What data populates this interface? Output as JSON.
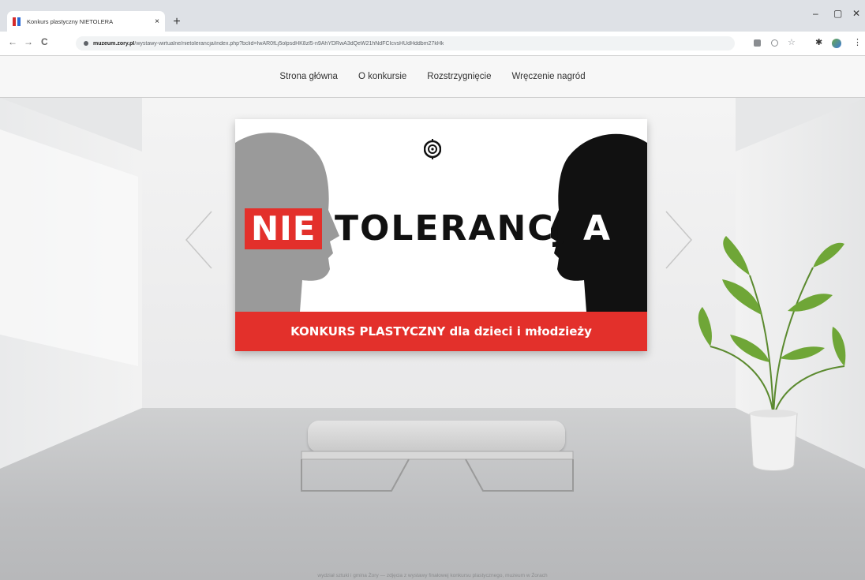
{
  "browser": {
    "tab_title": "Konkurs plastyczny NIETOLERA",
    "new_tab": "+",
    "close_tab": "×",
    "url_domain": "muzeum.zory.pl",
    "url_path": "/wystawy-wirtualne/nietolerancja/index.php?bclid=IwAR0fLj5olpsdHK8zl5-n9AhYDRwA3dQeW21hNdFCIcvsHUdHddbm27kHk",
    "window_controls": {
      "minimize": "–",
      "maximize": "▢",
      "close": "✕"
    },
    "nav": {
      "back": "←",
      "forward": "→",
      "reload": "C"
    }
  },
  "site_nav": {
    "items": [
      "Strona główna",
      "O konkursie",
      "Rozstrzygnięcie",
      "Wręczenie nagród"
    ]
  },
  "poster": {
    "word_nie": "NIE",
    "word_tolerancj": "TOLERANCJ",
    "word_a": "A",
    "banner": "KONKURS PLASTYCZNY dla dzieci i młodzieży"
  },
  "footer": {
    "text": "wydział sztuki i gmina Żory — zdjęcia z wystawy finałowej konkursu plastycznego, muzeum w Żorach"
  },
  "colors": {
    "accent_red": "#e3302b",
    "dark": "#111111",
    "gray_head": "#9a9a9a"
  },
  "icons": [
    "favicon-icon",
    "back-arrow-icon",
    "forward-arrow-icon",
    "reload-icon",
    "lock-icon",
    "screen-icon",
    "zoom-icon",
    "star-icon",
    "puzzle-icon",
    "profile-icon",
    "menu-icon",
    "emblem-icon",
    "prev-arrow-icon",
    "next-arrow-icon"
  ]
}
